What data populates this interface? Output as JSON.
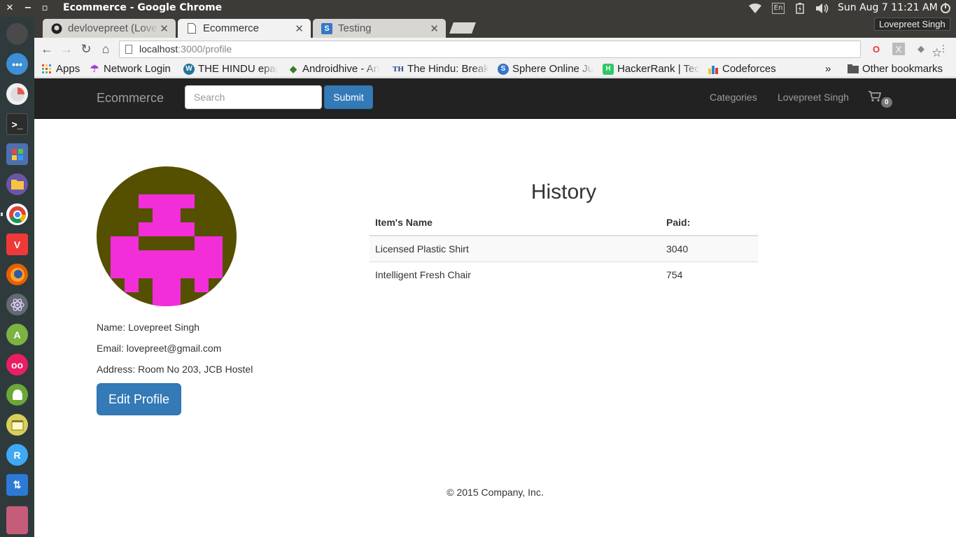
{
  "os": {
    "window_title": "Ecommerce - Google Chrome",
    "keyboard_layout": "En",
    "clock": "Sun Aug  7 11:21 AM",
    "launcher_icons": [
      "apple-icon",
      "dots-icon",
      "pie-icon",
      "terminal-icon",
      "apps-grid-icon",
      "files-icon",
      "chrome-icon",
      "vivaldi-icon",
      "firefox-icon",
      "atom-icon",
      "android-studio-icon",
      "flickr-icon",
      "android-icon",
      "archive-icon",
      "rstudio-icon",
      "update-icon",
      "stack-icon"
    ]
  },
  "browser": {
    "tabs": [
      {
        "title": "devlovepreet (Love",
        "icon": "github-icon"
      },
      {
        "title": "Ecommerce",
        "icon": "page-icon"
      },
      {
        "title": "Testing",
        "icon": "sphere-icon"
      }
    ],
    "profile_name": "Lovepreet Singh",
    "url_host": "localhost",
    "url_rest": ":3000/profile",
    "bookmarks": [
      {
        "label": "Apps",
        "icon": "apps-icon"
      },
      {
        "label": "Network Login",
        "icon": "umbrella-icon"
      },
      {
        "label": "THE HINDU epap",
        "icon": "wordpress-icon"
      },
      {
        "label": "Androidhive - An",
        "icon": "androidhive-icon"
      },
      {
        "label": "The Hindu: Break",
        "icon": "th-icon"
      },
      {
        "label": "Sphere Online Ju",
        "icon": "spoj-icon"
      },
      {
        "label": "HackerRank | Tec",
        "icon": "hackerrank-icon"
      },
      {
        "label": "Codeforces",
        "icon": "codeforces-icon"
      }
    ],
    "more_bookmarks": "»",
    "other_bookmarks": "Other bookmarks"
  },
  "site": {
    "brand": "Ecommerce",
    "search_placeholder": "Search",
    "submit_label": "Submit",
    "nav": {
      "categories": "Categories",
      "user": "Lovepreet Singh"
    },
    "cart_count": "0"
  },
  "profile": {
    "name_line": "Name: Lovepreet Singh",
    "email_line": "Email: lovepreet@gmail.com",
    "address_line": "Address: Room No 203, JCB Hostel",
    "edit_label": "Edit Profile",
    "avatar_colors": {
      "background": "#554f00",
      "foreground": "#f22ed8"
    }
  },
  "history": {
    "title": "History",
    "columns": [
      "Item's Name",
      "Paid:"
    ],
    "rows": [
      [
        "Licensed Plastic Shirt",
        "3040"
      ],
      [
        "Intelligent Fresh Chair",
        "754"
      ]
    ]
  },
  "footer": "© 2015 Company, Inc."
}
